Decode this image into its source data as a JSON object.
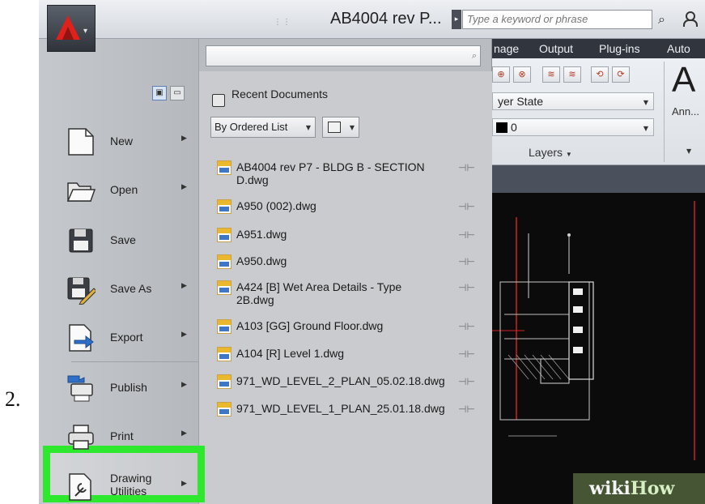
{
  "step_number": "2.",
  "window": {
    "title": "AB4004 rev P...",
    "search_placeholder": "Type a keyword or phrase",
    "qat_dots": "⋮⋮"
  },
  "ribbon": {
    "tabs": [
      "nage",
      "Output",
      "Plug-ins",
      "Auto"
    ],
    "layer_state_label": "yer State",
    "current_layer": "0",
    "panel_title": "Layers",
    "annotate_label": "Ann..."
  },
  "app_menu": {
    "search_value": "",
    "items": [
      {
        "label": "New",
        "has_submenu": true,
        "icon": "new-document-icon"
      },
      {
        "label": "Open",
        "has_submenu": true,
        "icon": "open-folder-icon"
      },
      {
        "label": "Save",
        "has_submenu": false,
        "icon": "floppy-disk-icon"
      },
      {
        "label": "Save As",
        "has_submenu": true,
        "icon": "save-as-icon"
      },
      {
        "label": "Export",
        "has_submenu": true,
        "icon": "export-icon"
      },
      {
        "label": "Publish",
        "has_submenu": true,
        "icon": "publish-icon"
      },
      {
        "label": "Print",
        "has_submenu": true,
        "icon": "printer-icon",
        "highlighted": true
      },
      {
        "label": "Drawing Utilities",
        "has_submenu": true,
        "icon": "drawing-utilities-icon"
      }
    ],
    "recent": {
      "heading": "Recent Documents",
      "order_by": "By Ordered List",
      "documents": [
        "AB4004 rev P7 - BLDG B - SECTION D.dwg",
        "A950 (002).dwg",
        "A951.dwg",
        "A950.dwg",
        "A424 [B] Wet Area Details - Type 2B.dwg",
        "A103 [GG] Ground Floor.dwg",
        "A104 [R] Level 1.dwg",
        "971_WD_LEVEL_2_PLAN_05.02.18.dwg",
        "971_WD_LEVEL_1_PLAN_25.01.18.dwg"
      ]
    }
  },
  "watermark": {
    "part1": "wiki",
    "part2": "How"
  },
  "colors": {
    "highlight": "#2de82d",
    "drawing_bg": "#0b0b0b"
  }
}
